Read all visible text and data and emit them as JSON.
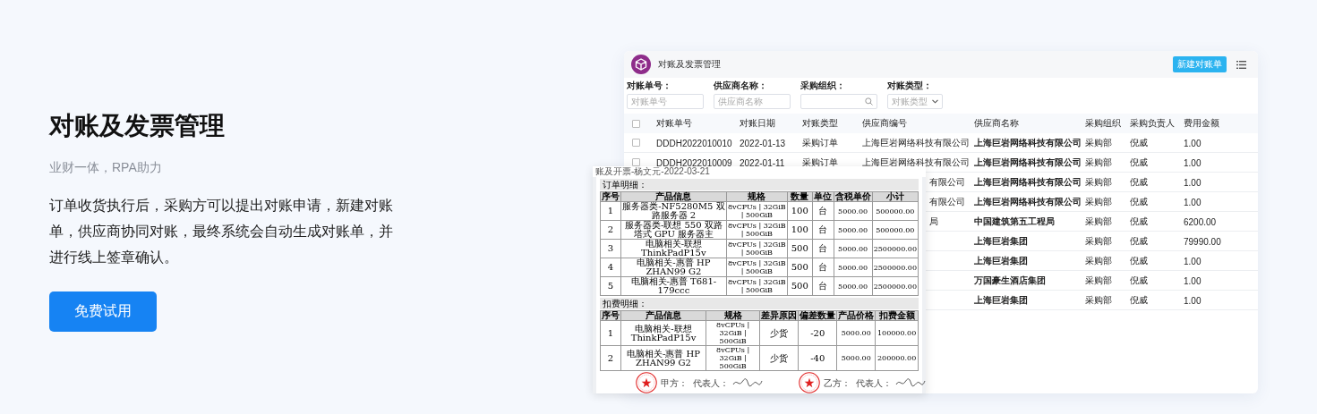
{
  "hero": {
    "title": "对账及发票管理",
    "subtitle": "业财一体，RPA助力",
    "description": "订单收货执行后，采购方可以提出对账申请，新建对账单，供应商协同对账，最终系统会自动生成对账单，并进行线上签章确认。",
    "button": "免费试用"
  },
  "app": {
    "title": "对账及发票管理",
    "new_button": "新建对账单",
    "all_checked": false,
    "filters": [
      {
        "kind": "text",
        "label": "对账单号：",
        "placeholder": "对账单号"
      },
      {
        "kind": "text",
        "label": "供应商名称：",
        "placeholder": "供应商名称"
      },
      {
        "kind": "search",
        "label": "采购组织："
      },
      {
        "kind": "select",
        "label": "对账类型：",
        "placeholder": "对账类型"
      }
    ],
    "columns": [
      "对账单号",
      "对账日期",
      "对账类型",
      "供应商编号",
      "供应商名称",
      "采购组织",
      "采购负责人",
      "费用金额"
    ],
    "rows": [
      {
        "checked": false,
        "cells": [
          "DDDH2022010010",
          "2022-01-13",
          "采购订单",
          "上海巨岩网络科技有限公司",
          "上海巨岩网络科技有限公司",
          "采购部",
          "倪威",
          "1.00"
        ]
      },
      {
        "checked": false,
        "cells": [
          "DDDH2022010009",
          "2022-01-11",
          "采购订单",
          "上海巨岩网络科技有限公司",
          "上海巨岩网络科技有限公司",
          "采购部",
          "倪威",
          "1.00"
        ]
      },
      {
        "cells": [
          "有限公司",
          "上海巨岩网络科技有限公司",
          "采购部",
          "倪威",
          "1.00"
        ]
      },
      {
        "cells": [
          "有限公司",
          "上海巨岩网络科技有限公司",
          "采购部",
          "倪威",
          "1.00"
        ]
      },
      {
        "cells": [
          "局",
          "中国建筑第五工程局",
          "采购部",
          "倪威",
          "6200.00"
        ]
      },
      {
        "cells": [
          "上海巨岩集团",
          "采购部",
          "倪威",
          "79990.00"
        ]
      },
      {
        "cells": [
          "上海巨岩集团",
          "采购部",
          "倪威",
          "1.00"
        ]
      },
      {
        "cells": [
          "万国豪生酒店集团",
          "采购部",
          "倪威",
          "1.00"
        ]
      },
      {
        "cells": [
          "上海巨岩集团",
          "采购部",
          "倪威",
          "1.00"
        ]
      }
    ]
  },
  "document": {
    "caption": "账及开票-杨文元-2022-03-21",
    "sections": [
      {
        "heading": "订单明细：",
        "columns": [
          "序号",
          "产品信息",
          "规格",
          "数量",
          "单位",
          "含税单价",
          "小计"
        ],
        "rows": [
          [
            "1",
            "服务器类-NF5280M5 双路服务器 2",
            "8vCPUs | 32GiB | 500GiB",
            "100",
            "台",
            "5000.00",
            "500000.00"
          ],
          [
            "2",
            "服务器类-联想 550 双路塔式 GPU 服务器主",
            "8vCPUs | 32GiB | 500GiB",
            "100",
            "台",
            "5000.00",
            "500000.00"
          ],
          [
            "3",
            "电脑相关-联想 ThinkPadP15v",
            "8vCPUs | 32GiB | 500GiB",
            "500",
            "台",
            "5000.00",
            "2500000.00"
          ],
          [
            "4",
            "电脑相关-惠普 HP ZHAN99 G2",
            "8vCPUs | 32GiB | 500GiB",
            "500",
            "台",
            "5000.00",
            "2500000.00"
          ],
          [
            "5",
            "电脑相关-惠普 T681-179ccc",
            "8vCPUs | 32GiB | 500GiB",
            "500",
            "台",
            "5000.00",
            "2500000.00"
          ]
        ]
      },
      {
        "heading": "扣费明细：",
        "columns": [
          "序号",
          "产品信息",
          "规格",
          "差异原因",
          "偏差数量",
          "产品价格",
          "扣费金额"
        ],
        "rows": [
          [
            "1",
            "电脑相关-联想 ThinkPadP15v",
            "8vCPUs | 32GiB | 500GiB",
            "少货",
            "-20",
            "5000.00",
            "100000.00"
          ],
          [
            "2",
            "电脑相关-惠普 HP ZHAN99 G2",
            "8vCPUs | 32GiB | 500GiB",
            "少货",
            "-40",
            "5000.00",
            "200000.00"
          ]
        ]
      }
    ],
    "signatures": [
      {
        "party": "甲方：",
        "rep": "代表人："
      },
      {
        "party": "乙方：",
        "rep": "代表人："
      }
    ]
  }
}
